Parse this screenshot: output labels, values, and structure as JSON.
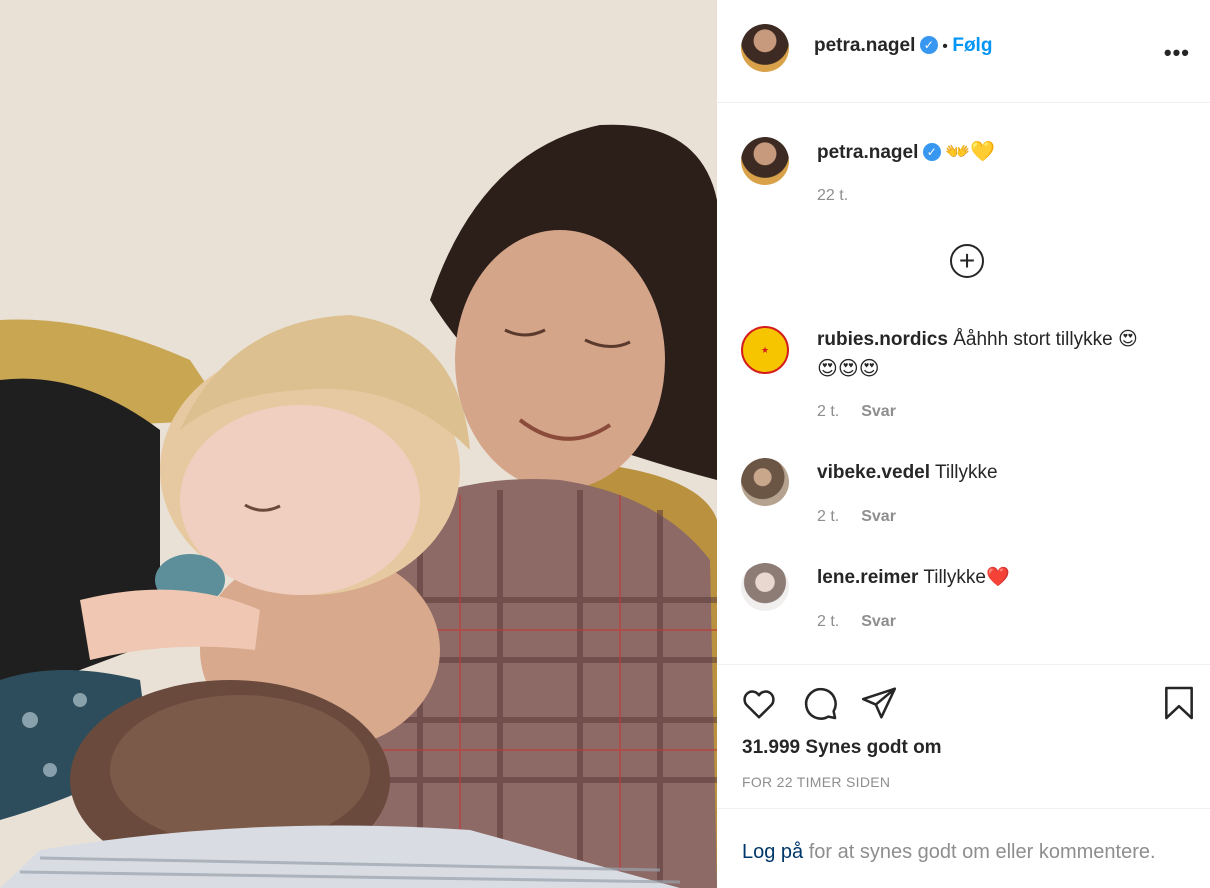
{
  "post": {
    "author": "petra.nagel",
    "follow_label": "Følg",
    "separator": "•",
    "more_label": "•••",
    "caption_emojis": "👐💛",
    "caption_time": "22 t.",
    "load_more_label": "+"
  },
  "comments": [
    {
      "user": "rubies.nordics",
      "text": "Ååhhh stort tillykke 😍",
      "text2": "😍😍😍",
      "time": "2 t.",
      "reply": "Svar"
    },
    {
      "user": "vibeke.vedel",
      "text": "Tillykke",
      "time": "2 t.",
      "reply": "Svar"
    },
    {
      "user": "lene.reimer",
      "text": "Tillykke❤️",
      "time": "2 t.",
      "reply": "Svar"
    }
  ],
  "footer": {
    "likes": "31.999 Synes godt om",
    "posted": "FOR 22 TIMER SIDEN",
    "login_link": "Log på",
    "login_rest": "for at synes godt om eller kommentere."
  },
  "colors": {
    "link_blue": "#0095f6",
    "verified_blue": "#3897f0",
    "muted": "#8e8e8e"
  }
}
